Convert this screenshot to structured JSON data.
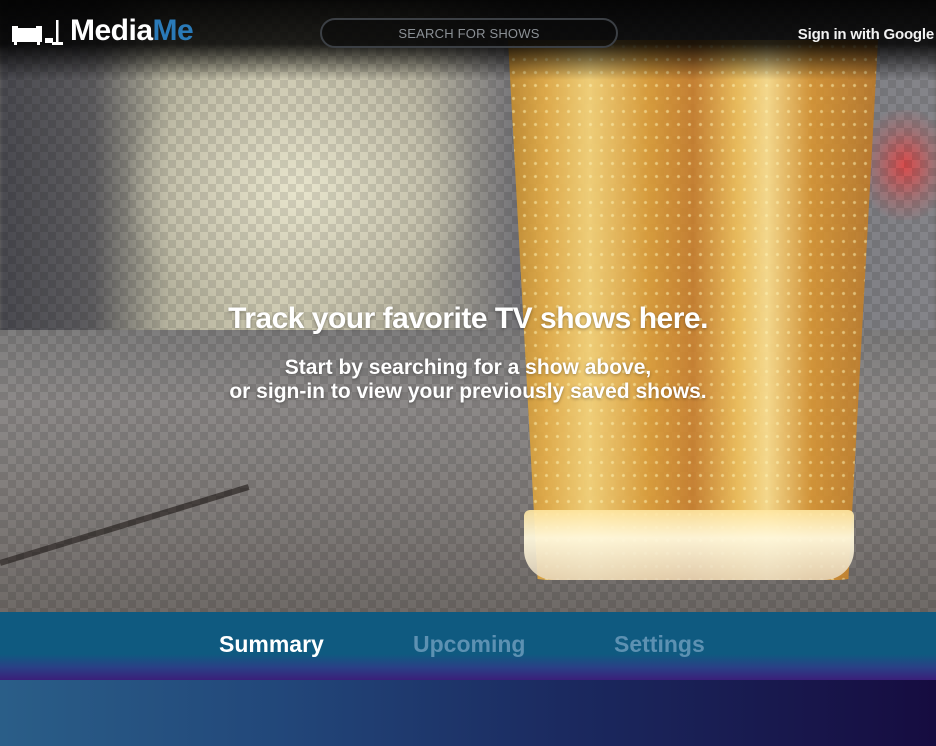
{
  "app": {
    "logo_text_a": "Media",
    "logo_text_b": "Me",
    "logo_icon": "couch-and-lamp-icon"
  },
  "header": {
    "search_placeholder": "SEARCH FOR SHOWS",
    "signin_label": "Sign in with Google"
  },
  "hero": {
    "headline": "Track your favorite TV shows here.",
    "subline_1": "Start by searching for a show above,",
    "subline_2": "or sign-in to view your previously saved shows."
  },
  "tabs": [
    {
      "label": "Summary",
      "active": true
    },
    {
      "label": "Upcoming",
      "active": false
    },
    {
      "label": "Settings",
      "active": false
    }
  ],
  "colors": {
    "brand_blue": "#2a7ab8",
    "tabbar": "#0f5a80",
    "tab_inactive": "#5d91b2",
    "tab_active": "#ffffff"
  }
}
